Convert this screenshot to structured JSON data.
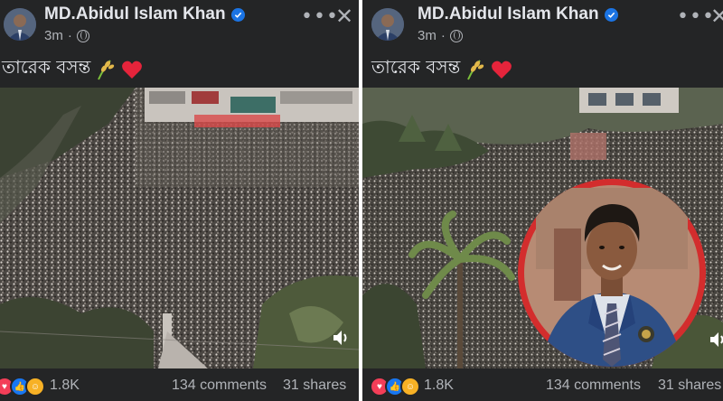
{
  "posts": [
    {
      "author": "MD.Abidul Islam Khan",
      "time": "3m",
      "caption": "তারেক বসন্ত",
      "reaction_count": "1.8K",
      "comments": "134 comments",
      "shares": "31 shares"
    },
    {
      "author": "MD.Abidul Islam Khan",
      "time": "3m",
      "caption": "তারেক বসন্ত",
      "reaction_count": "1.8K",
      "comments": "134 comments",
      "shares": "31 shares"
    }
  ],
  "ui": {
    "more_icon": "more-options-icon",
    "close_icon": "close-icon",
    "privacy_icon": "globe-icon",
    "sound_icon": "speaker-icon",
    "reactions": [
      "heart",
      "like",
      "care"
    ]
  },
  "colors": {
    "background": "#242526",
    "text": "#e4e6eb",
    "secondary": "#b0b3b8",
    "verified": "#1b74e4",
    "inset_ring": "#d32d2d"
  }
}
